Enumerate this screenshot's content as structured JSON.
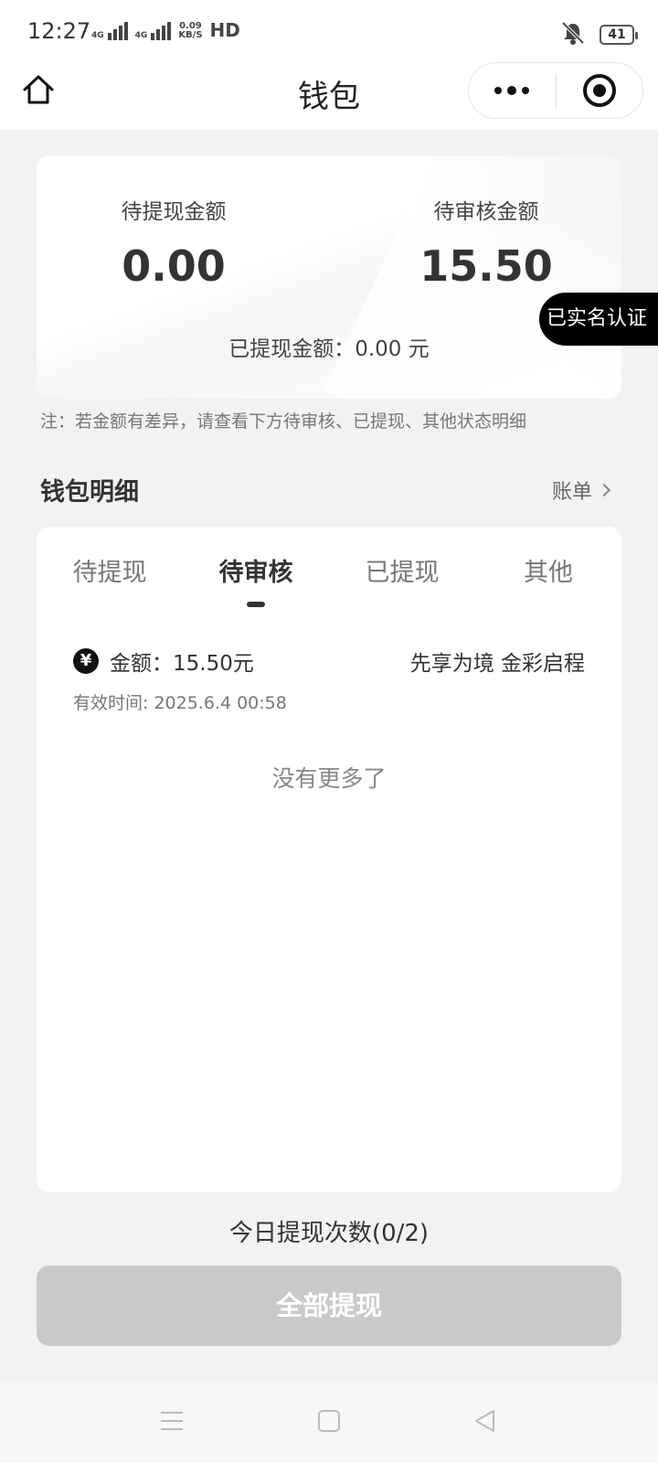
{
  "status_bar": {
    "time": "12:27",
    "network_1": "4G",
    "network_2": "4G",
    "speed_value": "0.09",
    "speed_unit": "KB/S",
    "hd": "HD",
    "battery": "41"
  },
  "nav": {
    "title": "钱包",
    "icons": {
      "home": "home-icon",
      "more": "more-dots-icon",
      "close": "target-close-icon"
    }
  },
  "summary": {
    "pending_withdraw_label": "待提现金额",
    "pending_withdraw_value": "0.00",
    "pending_review_label": "待审核金额",
    "pending_review_value": "15.50",
    "withdrawn_text": "已提现金额：0.00 元"
  },
  "verify_badge": "已实名认证",
  "note": "注：若金额有差异，请查看下方待审核、已提现、其他状态明细",
  "section": {
    "title": "钱包明细",
    "bill_link": "账单"
  },
  "tabs": [
    {
      "label": "待提现",
      "active": false
    },
    {
      "label": "待审核",
      "active": true
    },
    {
      "label": "已提现",
      "active": false
    },
    {
      "label": "其他",
      "active": false
    }
  ],
  "records": [
    {
      "icon": "yen-icon",
      "icon_text": "¥",
      "amount": "金额：15.50元",
      "description": "先享为境 金彩启程",
      "valid_time": "有效时间: 2025.6.4 00:58"
    }
  ],
  "no_more": "没有更多了",
  "daily_count": "今日提现次数(0/2)",
  "withdraw_all": "全部提现",
  "colors": {
    "background": "#f2f2f2",
    "badge_bg": "#000000",
    "button_disabled": "#c9c9c9"
  }
}
